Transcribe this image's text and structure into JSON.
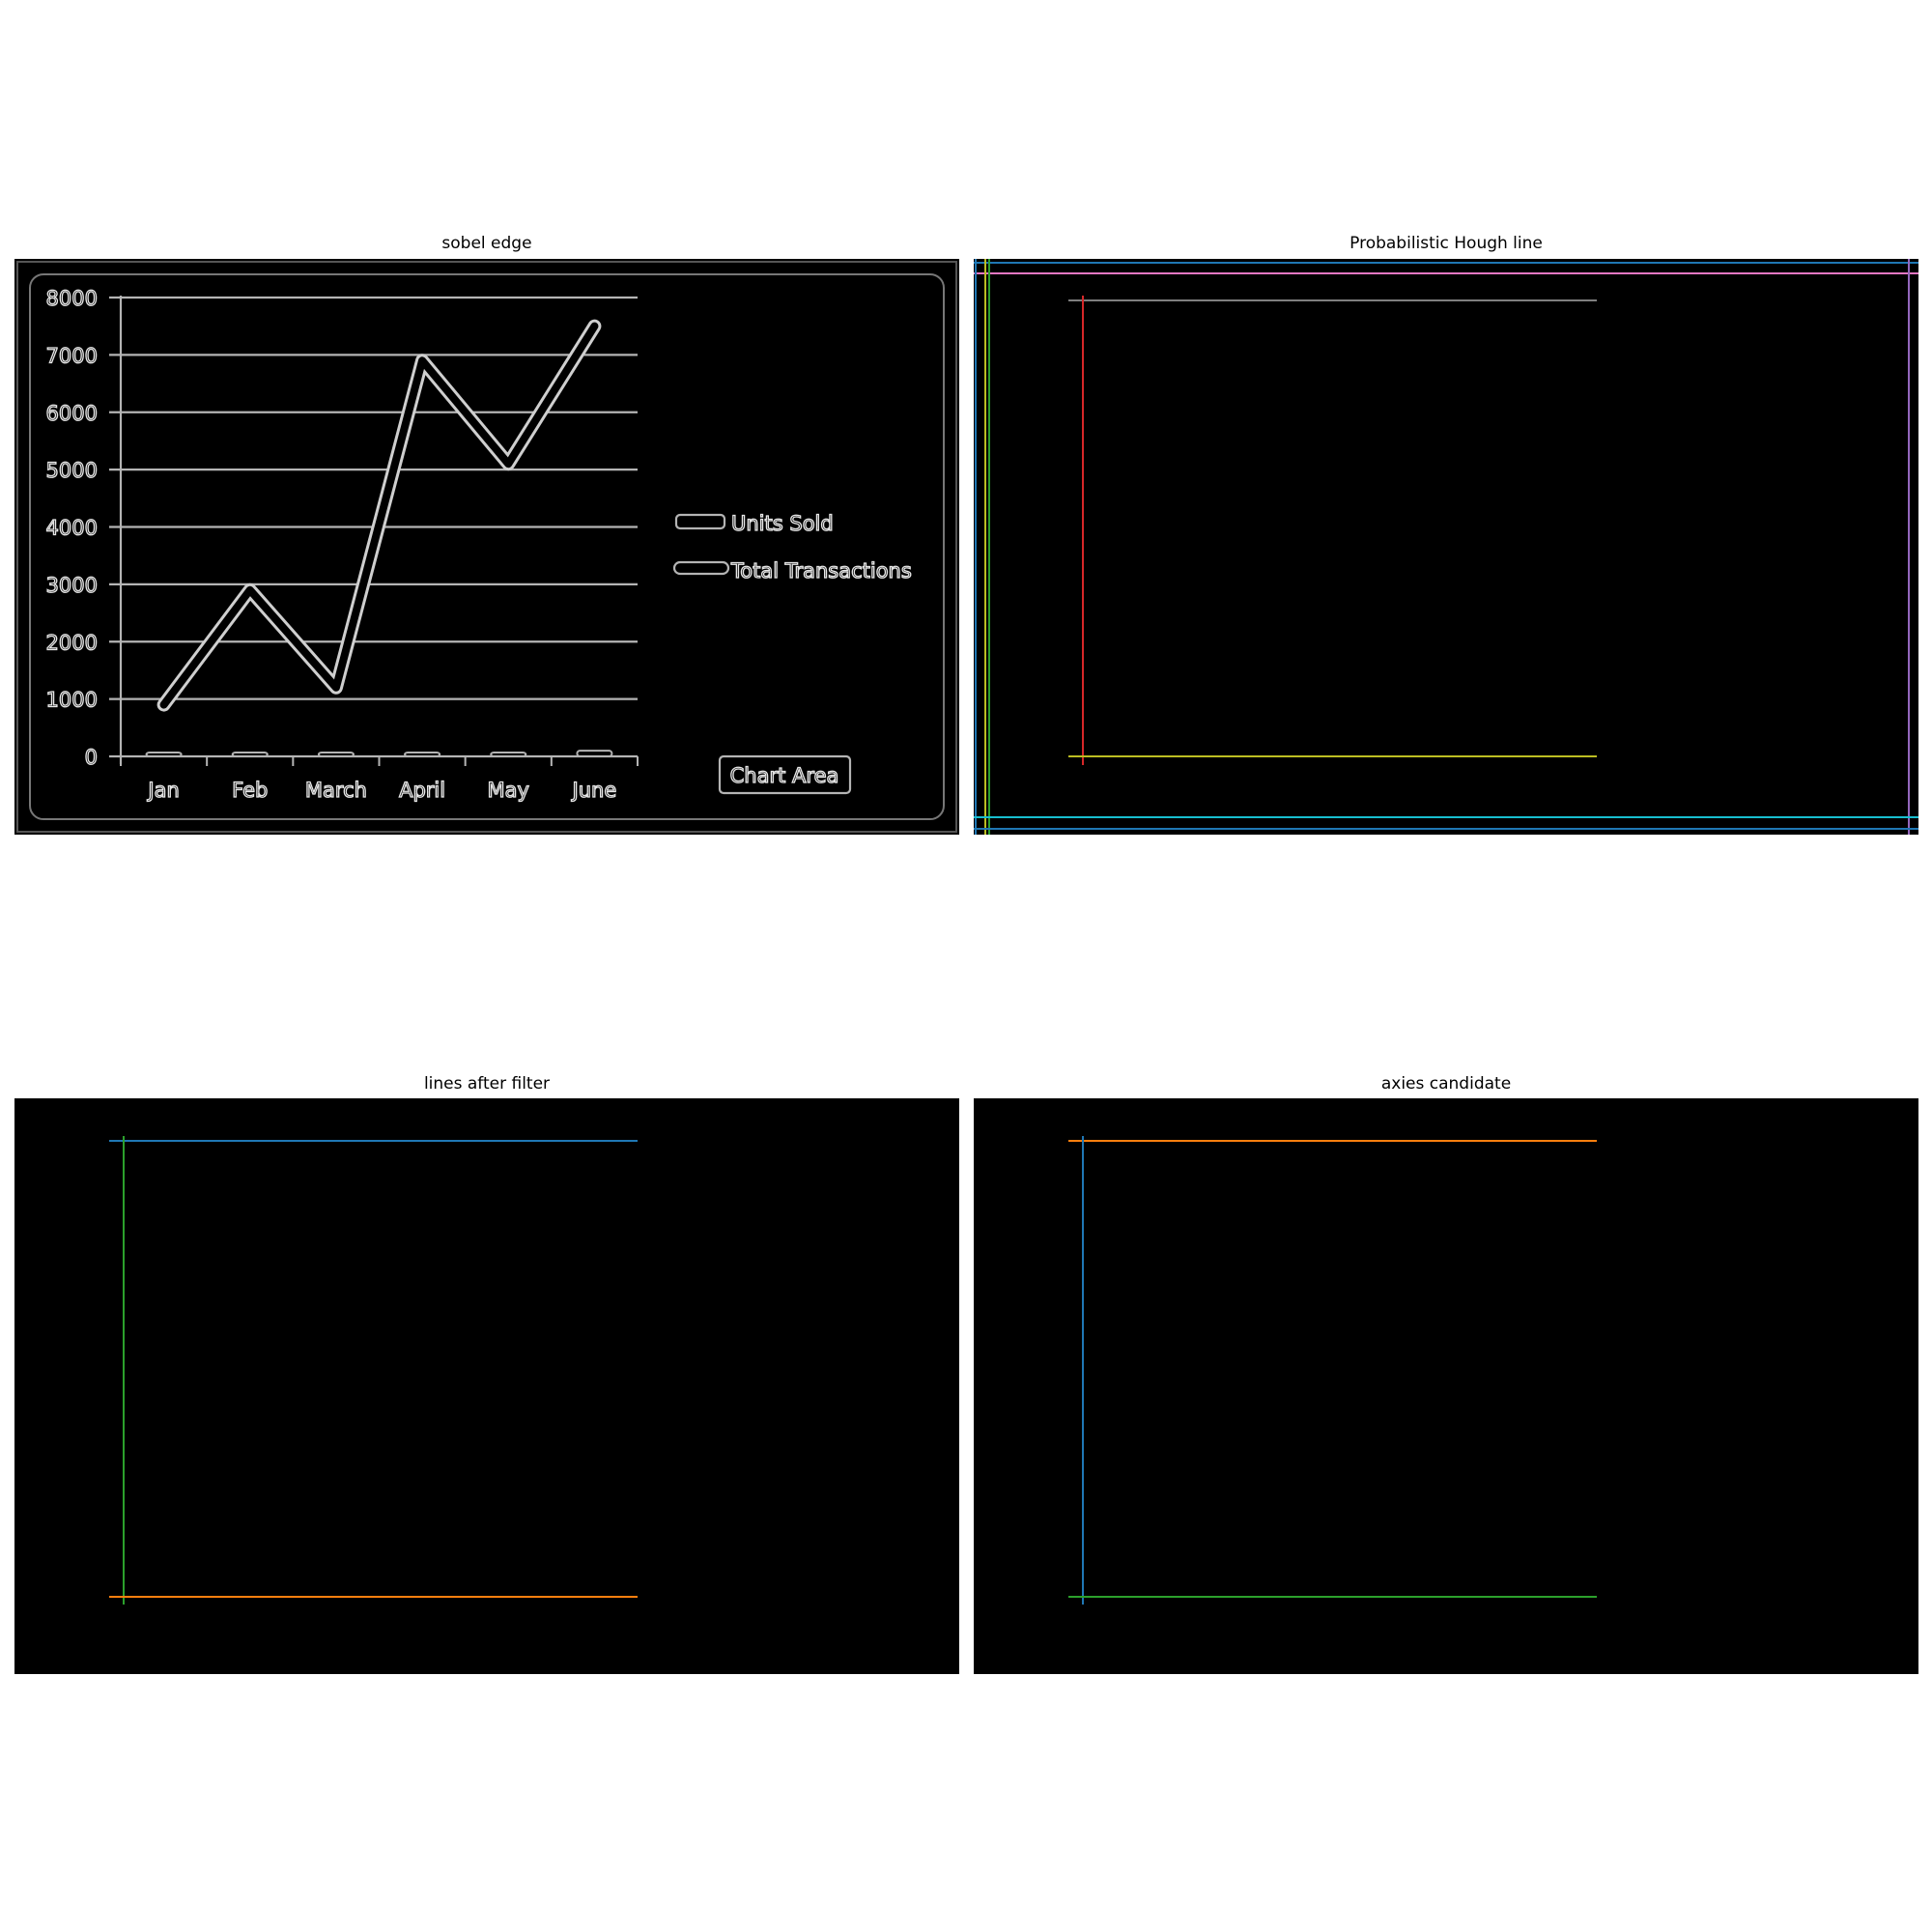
{
  "panels": {
    "sobel": {
      "title": "sobel edge"
    },
    "hough": {
      "title": "Probabilistic Hough line"
    },
    "filtered": {
      "title": "lines after filter"
    },
    "axes": {
      "title": "axies candidate"
    }
  },
  "chart_data": {
    "type": "line",
    "categories": [
      "Jan",
      "Feb",
      "March",
      "April",
      "May",
      "June"
    ],
    "series": [
      {
        "name": "Units Sold",
        "values": [
          0,
          50,
          0,
          50,
          30,
          100
        ]
      },
      {
        "name": "Total Transactions",
        "values": [
          900,
          2900,
          1200,
          6900,
          5100,
          7500
        ]
      }
    ],
    "y_ticks": [
      "0",
      "1000",
      "2000",
      "3000",
      "4000",
      "5000",
      "6000",
      "7000",
      "8000"
    ],
    "ylim": [
      0,
      8000
    ],
    "grid": true,
    "legend_position": "right",
    "chart_area_label": "Chart Area"
  },
  "colors": {
    "background": "#000000",
    "edge": "#b4b4b4",
    "blue": "#1f77b4",
    "orange": "#ff7f0e",
    "green": "#2ca02c",
    "red": "#d62728",
    "purple": "#9467bd",
    "olive": "#bcbd22",
    "gray": "#7f7f7f",
    "pink": "#e377c2",
    "cyan": "#17becf"
  }
}
